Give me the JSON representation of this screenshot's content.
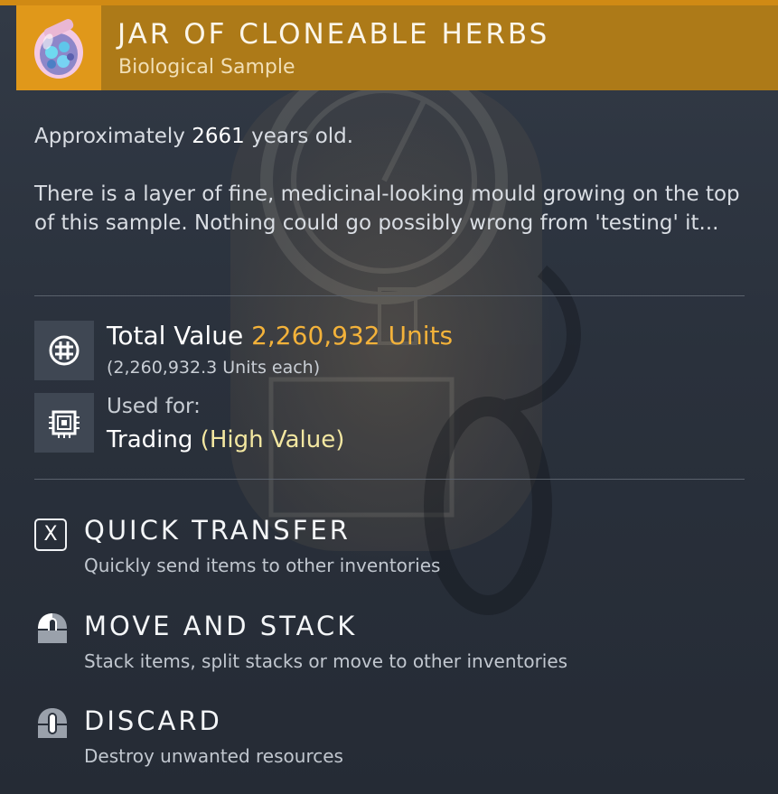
{
  "item": {
    "title": "JAR OF CLONEABLE HERBS",
    "category": "Biological Sample",
    "icon": "herb-jar-icon"
  },
  "description": {
    "age_prefix": "Approximately ",
    "age_value": "2661",
    "age_suffix": " years old.",
    "text": "There is a layer of fine, medicinal-looking mould growing on the top of this sample. Nothing could go possibly wrong from 'testing' it..."
  },
  "value": {
    "label": "Total Value ",
    "amount": "2,260,932 Units",
    "each": "(2,260,932.3 Units each)",
    "icon": "units-currency-icon"
  },
  "usage": {
    "label": "Used for:",
    "use": "Trading ",
    "qualifier": "(High Value)",
    "icon": "chip-icon"
  },
  "actions": [
    {
      "key": "X",
      "key_icon": "keycap-x-icon",
      "title": "QUICK TRANSFER",
      "subtitle": "Quickly send items to other inventories"
    },
    {
      "key_icon": "mouse-left-button-icon",
      "title": "MOVE AND STACK",
      "subtitle": "Stack items, split stacks or move to other inventories"
    },
    {
      "key_icon": "mouse-middle-button-icon",
      "title": "DISCARD",
      "subtitle": "Destroy unwanted resources"
    }
  ],
  "colors": {
    "header_bar": "#ad7a18",
    "accent_orange": "#e0981a",
    "value_gold": "#f3b23a",
    "panel_bg": "#2a313c"
  }
}
